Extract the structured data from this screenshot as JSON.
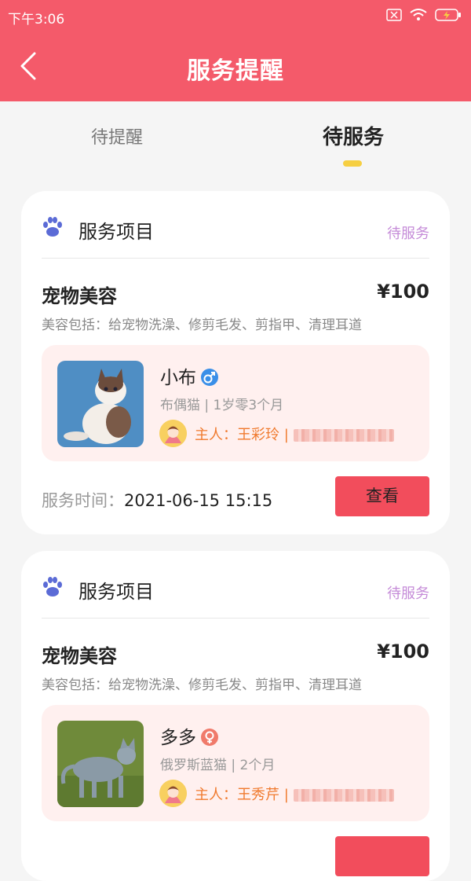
{
  "status_bar": {
    "time": "下午3:06"
  },
  "header": {
    "title": "服务提醒"
  },
  "tabs": [
    {
      "label": "待提醒",
      "active": false
    },
    {
      "label": "待服务",
      "active": true
    }
  ],
  "cards": [
    {
      "section_title": "服务项目",
      "status": "待服务",
      "service_name": "宠物美容",
      "price": "¥100",
      "description": "美容包括：给宠物洗澡、修剪毛发、剪指甲、清理耳道",
      "pet": {
        "name": "小布",
        "gender": "male",
        "info": "布偶猫 | 1岁零3个月"
      },
      "owner_label": "主人：王彩玲 | ",
      "time_label": "服务时间：",
      "time_value": "2021-06-15 15:15",
      "button_label": "查看"
    },
    {
      "section_title": "服务项目",
      "status": "待服务",
      "service_name": "宠物美容",
      "price": "¥100",
      "description": "美容包括：给宠物洗澡、修剪毛发、剪指甲、清理耳道",
      "pet": {
        "name": "多多",
        "gender": "female",
        "info": "俄罗斯蓝猫 | 2个月"
      },
      "owner_label": "主人：王秀芹 | "
    }
  ],
  "colors": {
    "header": "#f45a6a",
    "accent": "#f24d5c",
    "status": "#c58bd8",
    "owner": "#f07a2e",
    "tab_indicator": "#f6cf42"
  }
}
